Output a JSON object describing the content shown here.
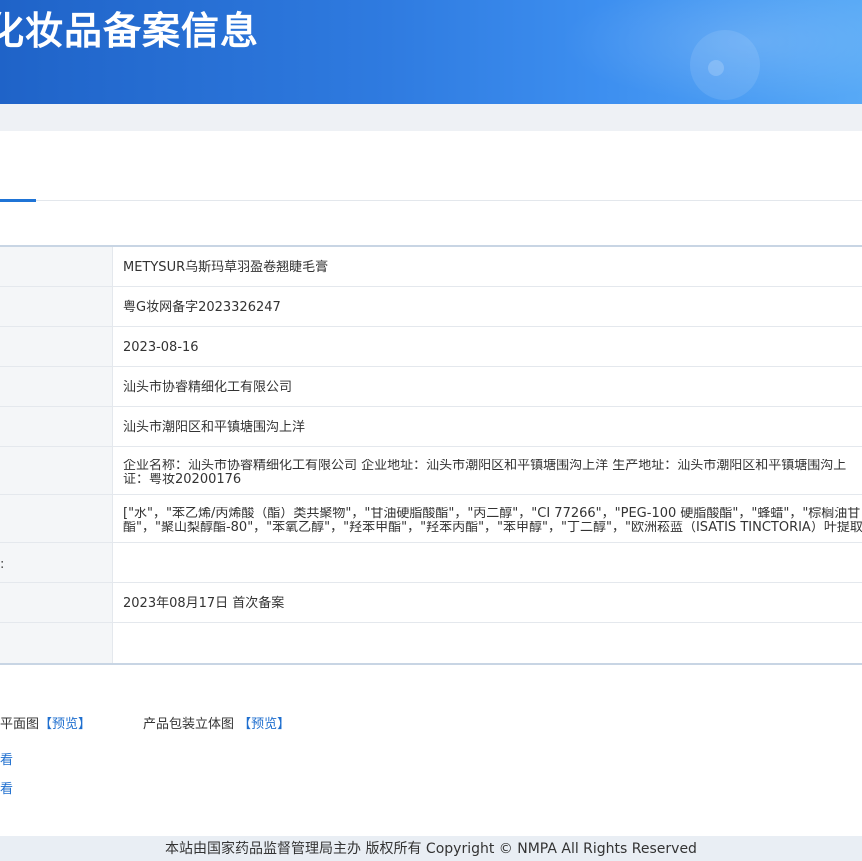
{
  "banner": {
    "title": "化妆品备案信息"
  },
  "table": {
    "rows": [
      {
        "label": "",
        "value": "METYSUR乌斯玛草羽盈卷翘睫毛膏"
      },
      {
        "label": "",
        "value": "粤G妆网备字2023326247"
      },
      {
        "label": "",
        "value": "2023-08-16"
      },
      {
        "label": "",
        "value": "汕头市协睿精细化工有限公司"
      },
      {
        "label": "",
        "value": "汕头市潮阳区和平镇塘围沟上洋"
      },
      {
        "label": "",
        "value_line1": "企业名称：汕头市协睿精细化工有限公司 企业地址：汕头市潮阳区和平镇塘围沟上洋 生产地址：汕头市潮阳区和平镇塘围沟上",
        "value_line2": "证：粤妆20200176"
      },
      {
        "label": "",
        "value_line1": "[\"水\"，\"苯乙烯/丙烯酸（酯）类共聚物\"，\"甘油硬脂酸酯\"，\"丙二醇\"，\"CI 77266\"，\"PEG-100 硬脂酸酯\"，\"蜂蜡\"，\"棕榈油甘",
        "value_line2": "酯\"，\"聚山梨醇酯-80\"，\"苯氧乙醇\"，\"羟苯甲酯\"，\"羟苯丙酯\"，\"苯甲醇\"，\"丁二醇\"，\"欧洲菘蓝（ISATIS TINCTORIA）叶提取"
      },
      {
        "label": ":",
        "value": ""
      },
      {
        "label": "",
        "value": "2023年08月17日 首次备案"
      },
      {
        "label": "",
        "value": ""
      }
    ]
  },
  "attachments": {
    "flat_label": "平面图",
    "flat_preview": "【预览】",
    "stereo_label": "产品包装立体图",
    "stereo_preview": "【预览】",
    "view1": "看",
    "view2": "看"
  },
  "footer": {
    "text": "本站由国家药品监督管理局主办 版权所有 Copyright © NMPA All Rights Reserved"
  }
}
